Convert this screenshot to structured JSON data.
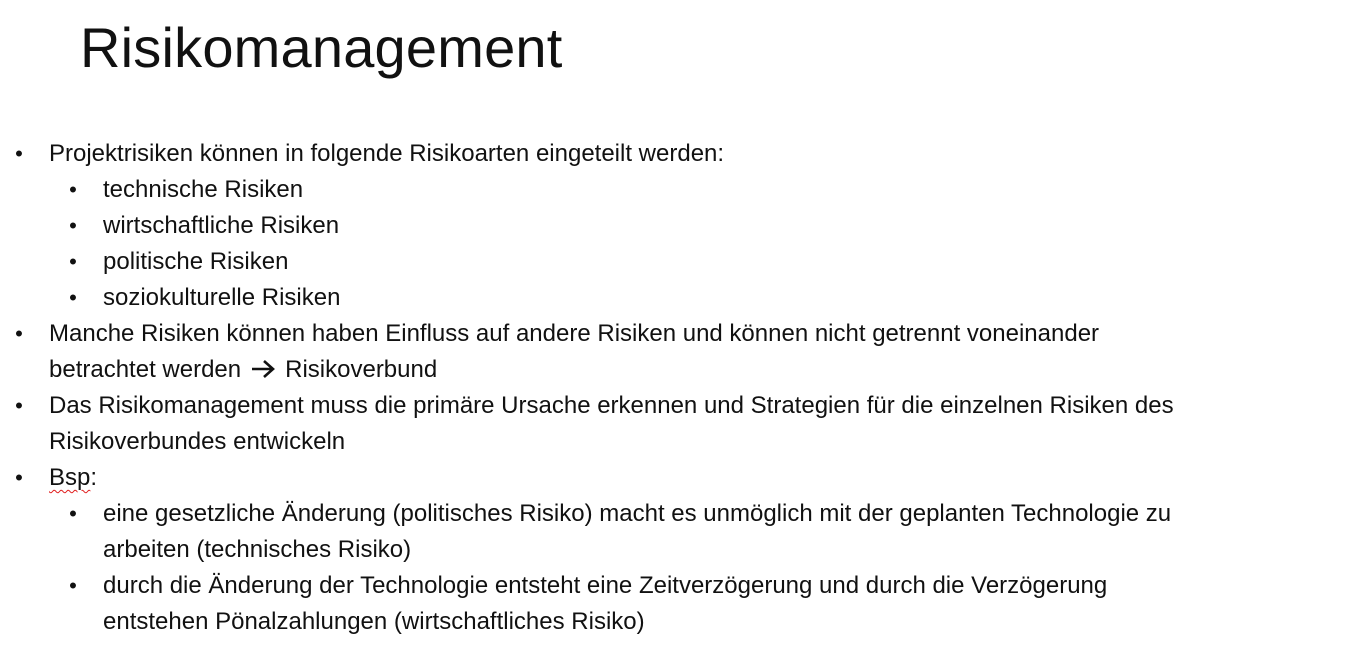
{
  "slide": {
    "title": "Risikomanagement",
    "bullet_char": "•",
    "items": [
      {
        "text": "Projektrisiken können in folgende Risikoarten eingeteilt werden:"
      },
      {
        "text": "technische Risiken"
      },
      {
        "text": "wirtschaftliche Risiken"
      },
      {
        "text": "politische Risiken"
      },
      {
        "text": "soziokulturelle Risiken"
      },
      {
        "line1": "Manche Risiken können haben Einfluss auf andere Risiken und können nicht getrennt voneinander",
        "line2_before": "betrachtet werden",
        "arrow_icon": "right-arrow-icon",
        "line2_after": "Risikoverbund"
      },
      {
        "line1": "Das Risikomanagement muss die primäre Ursache erkennen und Strategien für die einzelnen Risiken des",
        "line2": "Risikoverbundes entwickeln"
      },
      {
        "text": "Bsp",
        "suffix": ":"
      },
      {
        "line1": "eine gesetzliche Änderung (politisches Risiko) macht es unmöglich mit der geplanten Technologie zu",
        "line2": "arbeiten (technisches Risiko)"
      },
      {
        "line1": "durch die Änderung der Technologie entsteht eine Zeitverzögerung und durch die Verzögerung",
        "line2": "entstehen Pönalzahlungen (wirtschaftliches Risiko)"
      }
    ]
  },
  "colors": {
    "text": "#111111",
    "background": "#ffffff",
    "spellcheck_underline": "#e01b1b"
  }
}
